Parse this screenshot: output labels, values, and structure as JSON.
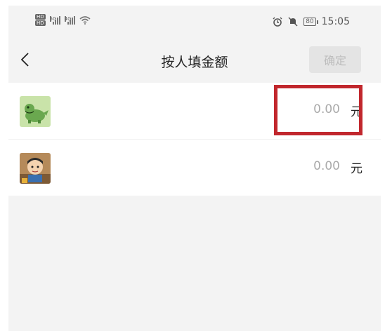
{
  "status_bar": {
    "hd_badges": [
      "HD",
      "HD"
    ],
    "network_labels": [
      "5G",
      "4G"
    ],
    "battery": "80",
    "time": "15:05"
  },
  "nav": {
    "title": "按人填金额",
    "confirm_label": "确定"
  },
  "rows": [
    {
      "name": "",
      "amount_placeholder": "0.00",
      "unit": "元"
    },
    {
      "name": "",
      "amount_placeholder": "0.00",
      "unit": "元"
    }
  ],
  "colors": {
    "highlight": "#c1272d",
    "background": "#f3f3f3",
    "placeholder": "#aaaaaa"
  }
}
